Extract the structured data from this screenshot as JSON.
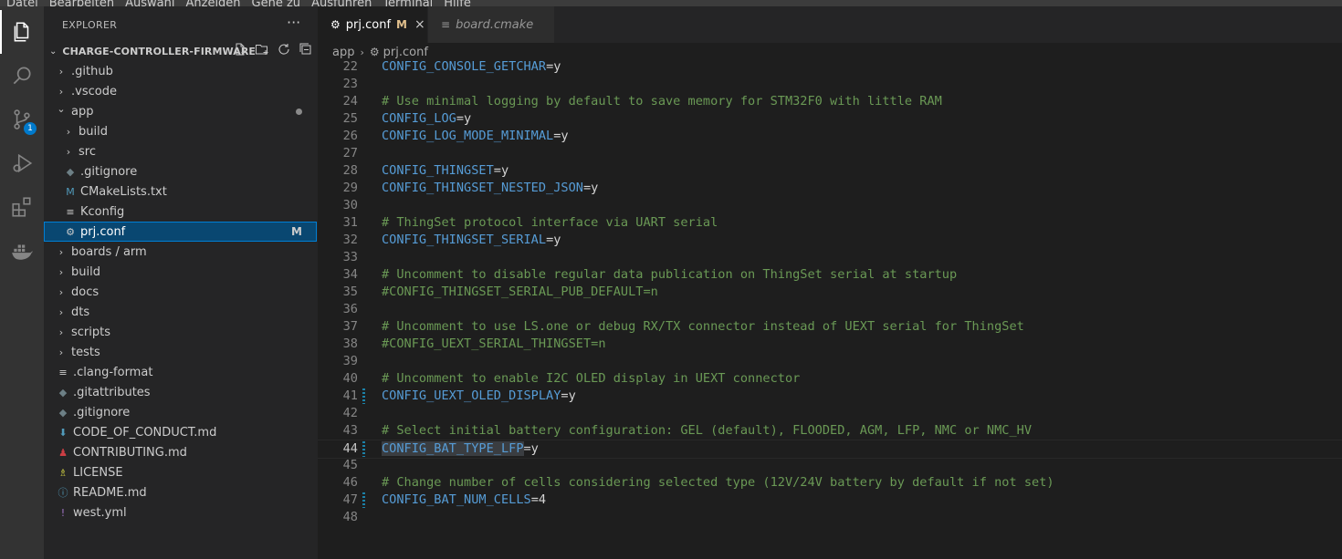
{
  "menubar": [
    "Datei",
    "Bearbeiten",
    "Auswahl",
    "Anzeigen",
    "Gehe zu",
    "Ausführen",
    "Terminal",
    "Hilfe"
  ],
  "activity": {
    "scm_badge": "1"
  },
  "sidebar": {
    "title": "EXPLORER",
    "more": "···",
    "root": "CHARGE-CONTROLLER-FIRMWARE",
    "items": [
      {
        "label": ".github",
        "type": "folder",
        "depth": 0,
        "expanded": false
      },
      {
        "label": ".vscode",
        "type": "folder",
        "depth": 0,
        "expanded": false
      },
      {
        "label": "app",
        "type": "folder",
        "depth": 0,
        "expanded": true,
        "dot": true
      },
      {
        "label": "build",
        "type": "folder",
        "depth": 1,
        "expanded": false
      },
      {
        "label": "src",
        "type": "folder",
        "depth": 1,
        "expanded": false
      },
      {
        "label": ".gitignore",
        "type": "file",
        "depth": 1,
        "icon": "◆",
        "icon_color": "#6d8086"
      },
      {
        "label": "CMakeLists.txt",
        "type": "file",
        "depth": 1,
        "icon": "M",
        "icon_color": "#519aba"
      },
      {
        "label": "Kconfig",
        "type": "file",
        "depth": 1,
        "icon": "≡",
        "icon_color": "#cccccc"
      },
      {
        "label": "prj.conf",
        "type": "file",
        "depth": 1,
        "icon": "⚙",
        "icon_color": "#cccccc",
        "status": "M",
        "selected": true
      },
      {
        "label": "boards / arm",
        "type": "folder",
        "depth": 0,
        "expanded": false
      },
      {
        "label": "build",
        "type": "folder",
        "depth": 0,
        "expanded": false
      },
      {
        "label": "docs",
        "type": "folder",
        "depth": 0,
        "expanded": false
      },
      {
        "label": "dts",
        "type": "folder",
        "depth": 0,
        "expanded": false
      },
      {
        "label": "scripts",
        "type": "folder",
        "depth": 0,
        "expanded": false
      },
      {
        "label": "tests",
        "type": "folder",
        "depth": 0,
        "expanded": false
      },
      {
        "label": ".clang-format",
        "type": "file",
        "depth": 0,
        "icon": "≡",
        "icon_color": "#cccccc"
      },
      {
        "label": ".gitattributes",
        "type": "file",
        "depth": 0,
        "icon": "◆",
        "icon_color": "#6d8086"
      },
      {
        "label": ".gitignore",
        "type": "file",
        "depth": 0,
        "icon": "◆",
        "icon_color": "#6d8086"
      },
      {
        "label": "CODE_OF_CONDUCT.md",
        "type": "file",
        "depth": 0,
        "icon": "⬇",
        "icon_color": "#519aba"
      },
      {
        "label": "CONTRIBUTING.md",
        "type": "file",
        "depth": 0,
        "icon": "♟",
        "icon_color": "#cc3e44"
      },
      {
        "label": "LICENSE",
        "type": "file",
        "depth": 0,
        "icon": "♗",
        "icon_color": "#cbcb41"
      },
      {
        "label": "README.md",
        "type": "file",
        "depth": 0,
        "icon": "ⓘ",
        "icon_color": "#519aba"
      },
      {
        "label": "west.yml",
        "type": "file",
        "depth": 0,
        "icon": "!",
        "icon_color": "#a074c4"
      }
    ]
  },
  "tabs": [
    {
      "label": "prj.conf",
      "modified": "M",
      "close": "×"
    },
    {
      "label": "board.cmake"
    }
  ],
  "breadcrumb": {
    "folder": "app",
    "file": "prj.conf"
  },
  "editor": {
    "lines": [
      {
        "n": "22",
        "parts": [
          [
            "k",
            "CONFIG_CONSOLE_GETCHAR"
          ],
          [
            "v",
            "=y"
          ]
        ]
      },
      {
        "n": "23",
        "parts": []
      },
      {
        "n": "24",
        "parts": [
          [
            "c",
            "# Use minimal logging by default to save memory for STM32F0 with little RAM"
          ]
        ]
      },
      {
        "n": "25",
        "parts": [
          [
            "k",
            "CONFIG_LOG"
          ],
          [
            "v",
            "=y"
          ]
        ]
      },
      {
        "n": "26",
        "parts": [
          [
            "k",
            "CONFIG_LOG_MODE_MINIMAL"
          ],
          [
            "v",
            "=y"
          ]
        ]
      },
      {
        "n": "27",
        "parts": []
      },
      {
        "n": "28",
        "parts": [
          [
            "k",
            "CONFIG_THINGSET"
          ],
          [
            "v",
            "=y"
          ]
        ]
      },
      {
        "n": "29",
        "parts": [
          [
            "k",
            "CONFIG_THINGSET_NESTED_JSON"
          ],
          [
            "v",
            "=y"
          ]
        ]
      },
      {
        "n": "30",
        "parts": []
      },
      {
        "n": "31",
        "parts": [
          [
            "c",
            "# ThingSet protocol interface via UART serial"
          ]
        ]
      },
      {
        "n": "32",
        "parts": [
          [
            "k",
            "CONFIG_THINGSET_SERIAL"
          ],
          [
            "v",
            "=y"
          ]
        ]
      },
      {
        "n": "33",
        "parts": []
      },
      {
        "n": "34",
        "parts": [
          [
            "c",
            "# Uncomment to disable regular data publication on ThingSet serial at startup"
          ]
        ]
      },
      {
        "n": "35",
        "parts": [
          [
            "c",
            "#CONFIG_THINGSET_SERIAL_PUB_DEFAULT=n"
          ]
        ]
      },
      {
        "n": "36",
        "parts": []
      },
      {
        "n": "37",
        "parts": [
          [
            "c",
            "# Uncomment to use LS.one or debug RX/TX connector instead of UEXT serial for ThingSet"
          ]
        ]
      },
      {
        "n": "38",
        "parts": [
          [
            "c",
            "#CONFIG_UEXT_SERIAL_THINGSET=n"
          ]
        ]
      },
      {
        "n": "39",
        "parts": []
      },
      {
        "n": "40",
        "parts": [
          [
            "c",
            "# Uncomment to enable I2C OLED display in UEXT connector"
          ]
        ]
      },
      {
        "n": "41",
        "parts": [
          [
            "k",
            "CONFIG_UEXT_OLED_DISPLAY"
          ],
          [
            "v",
            "=y"
          ]
        ],
        "changed": true
      },
      {
        "n": "42",
        "parts": []
      },
      {
        "n": "43",
        "parts": [
          [
            "c",
            "# Select initial battery configuration: GEL (default), FLOODED, AGM, LFP, NMC or NMC_HV"
          ]
        ]
      },
      {
        "n": "44",
        "parts": [
          [
            "ksel",
            "CONFIG_BAT_TYPE_LFP"
          ],
          [
            "v",
            "=y"
          ]
        ],
        "changed": true,
        "current": true
      },
      {
        "n": "45",
        "parts": []
      },
      {
        "n": "46",
        "parts": [
          [
            "c",
            "# Change number of cells considering selected type (12V/24V battery by default if not set)"
          ]
        ]
      },
      {
        "n": "47",
        "parts": [
          [
            "k",
            "CONFIG_BAT_NUM_CELLS"
          ],
          [
            "v",
            "=4"
          ]
        ],
        "changed": true
      },
      {
        "n": "48",
        "parts": []
      }
    ]
  }
}
